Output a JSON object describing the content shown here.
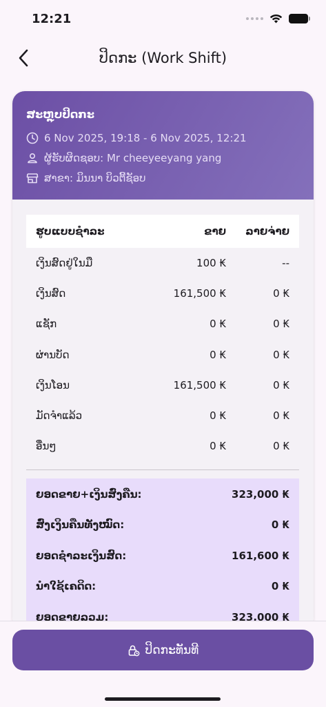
{
  "status_bar": {
    "time": "12:21"
  },
  "app_bar": {
    "title": "ປິດກະ (Work Shift)"
  },
  "summary_card": {
    "title": "ສະຫຼຸບປິດກະ",
    "period": "6 Nov 2025, 19:18 - 6 Nov 2025, 12:21",
    "responsible": "ຜູ້ຮັບຜິດຊອບ: Mr cheeyeeyang yang",
    "branch": "ສາຂາ: ມິນນາ ບິວຕີ້ຊັອບ"
  },
  "payment_table": {
    "headers": {
      "method": "ຮູບແບບຊໍາລະ",
      "sales": "ຂາຍ",
      "expense": "ລາຍຈ່າຍ"
    },
    "rows": [
      {
        "method": "ເງິນສົດຢູ່ໃນມື",
        "sales": "100 ₭",
        "expense": "--"
      },
      {
        "method": "ເງິນສົດ",
        "sales": "161,500 ₭",
        "expense": "0 ₭"
      },
      {
        "method": "ແຊັກ",
        "sales": "0 ₭",
        "expense": "0 ₭"
      },
      {
        "method": "ຜ່ານບັດ",
        "sales": "0 ₭",
        "expense": "0 ₭"
      },
      {
        "method": "ເງິນໂອນ",
        "sales": "161,500 ₭",
        "expense": "0 ₭"
      },
      {
        "method": "ມັດຈໍາແລ້ວ",
        "sales": "0 ₭",
        "expense": "0 ₭"
      },
      {
        "method": "ອື່ນໆ",
        "sales": "0 ₭",
        "expense": "0 ₭"
      }
    ]
  },
  "totals": [
    {
      "label": "ຍອດຂາຍ+ເງິນສົ່ງຄືນ:",
      "value": "323,000 ₭"
    },
    {
      "label": "ສົ່ງເງິນຄືນທັງໝົດ:",
      "value": "0 ₭"
    },
    {
      "label": "ຍອດຊໍາລະເງິນສົດ:",
      "value": "161,600 ₭"
    },
    {
      "label": "ນໍາໃຊ້ເຄດິດ:",
      "value": "0 ₭"
    },
    {
      "label": "ຍອດຂາຍລວມ:",
      "value": "323,000 ₭"
    }
  ],
  "bottom": {
    "close_button_label": "ປິດກະທັນທີ"
  },
  "colors": {
    "primary": "#6a4fa3",
    "header_gradient_end": "#8470bb",
    "summary_bg": "#e8dcfb",
    "page_bg": "#fbf5fb"
  }
}
